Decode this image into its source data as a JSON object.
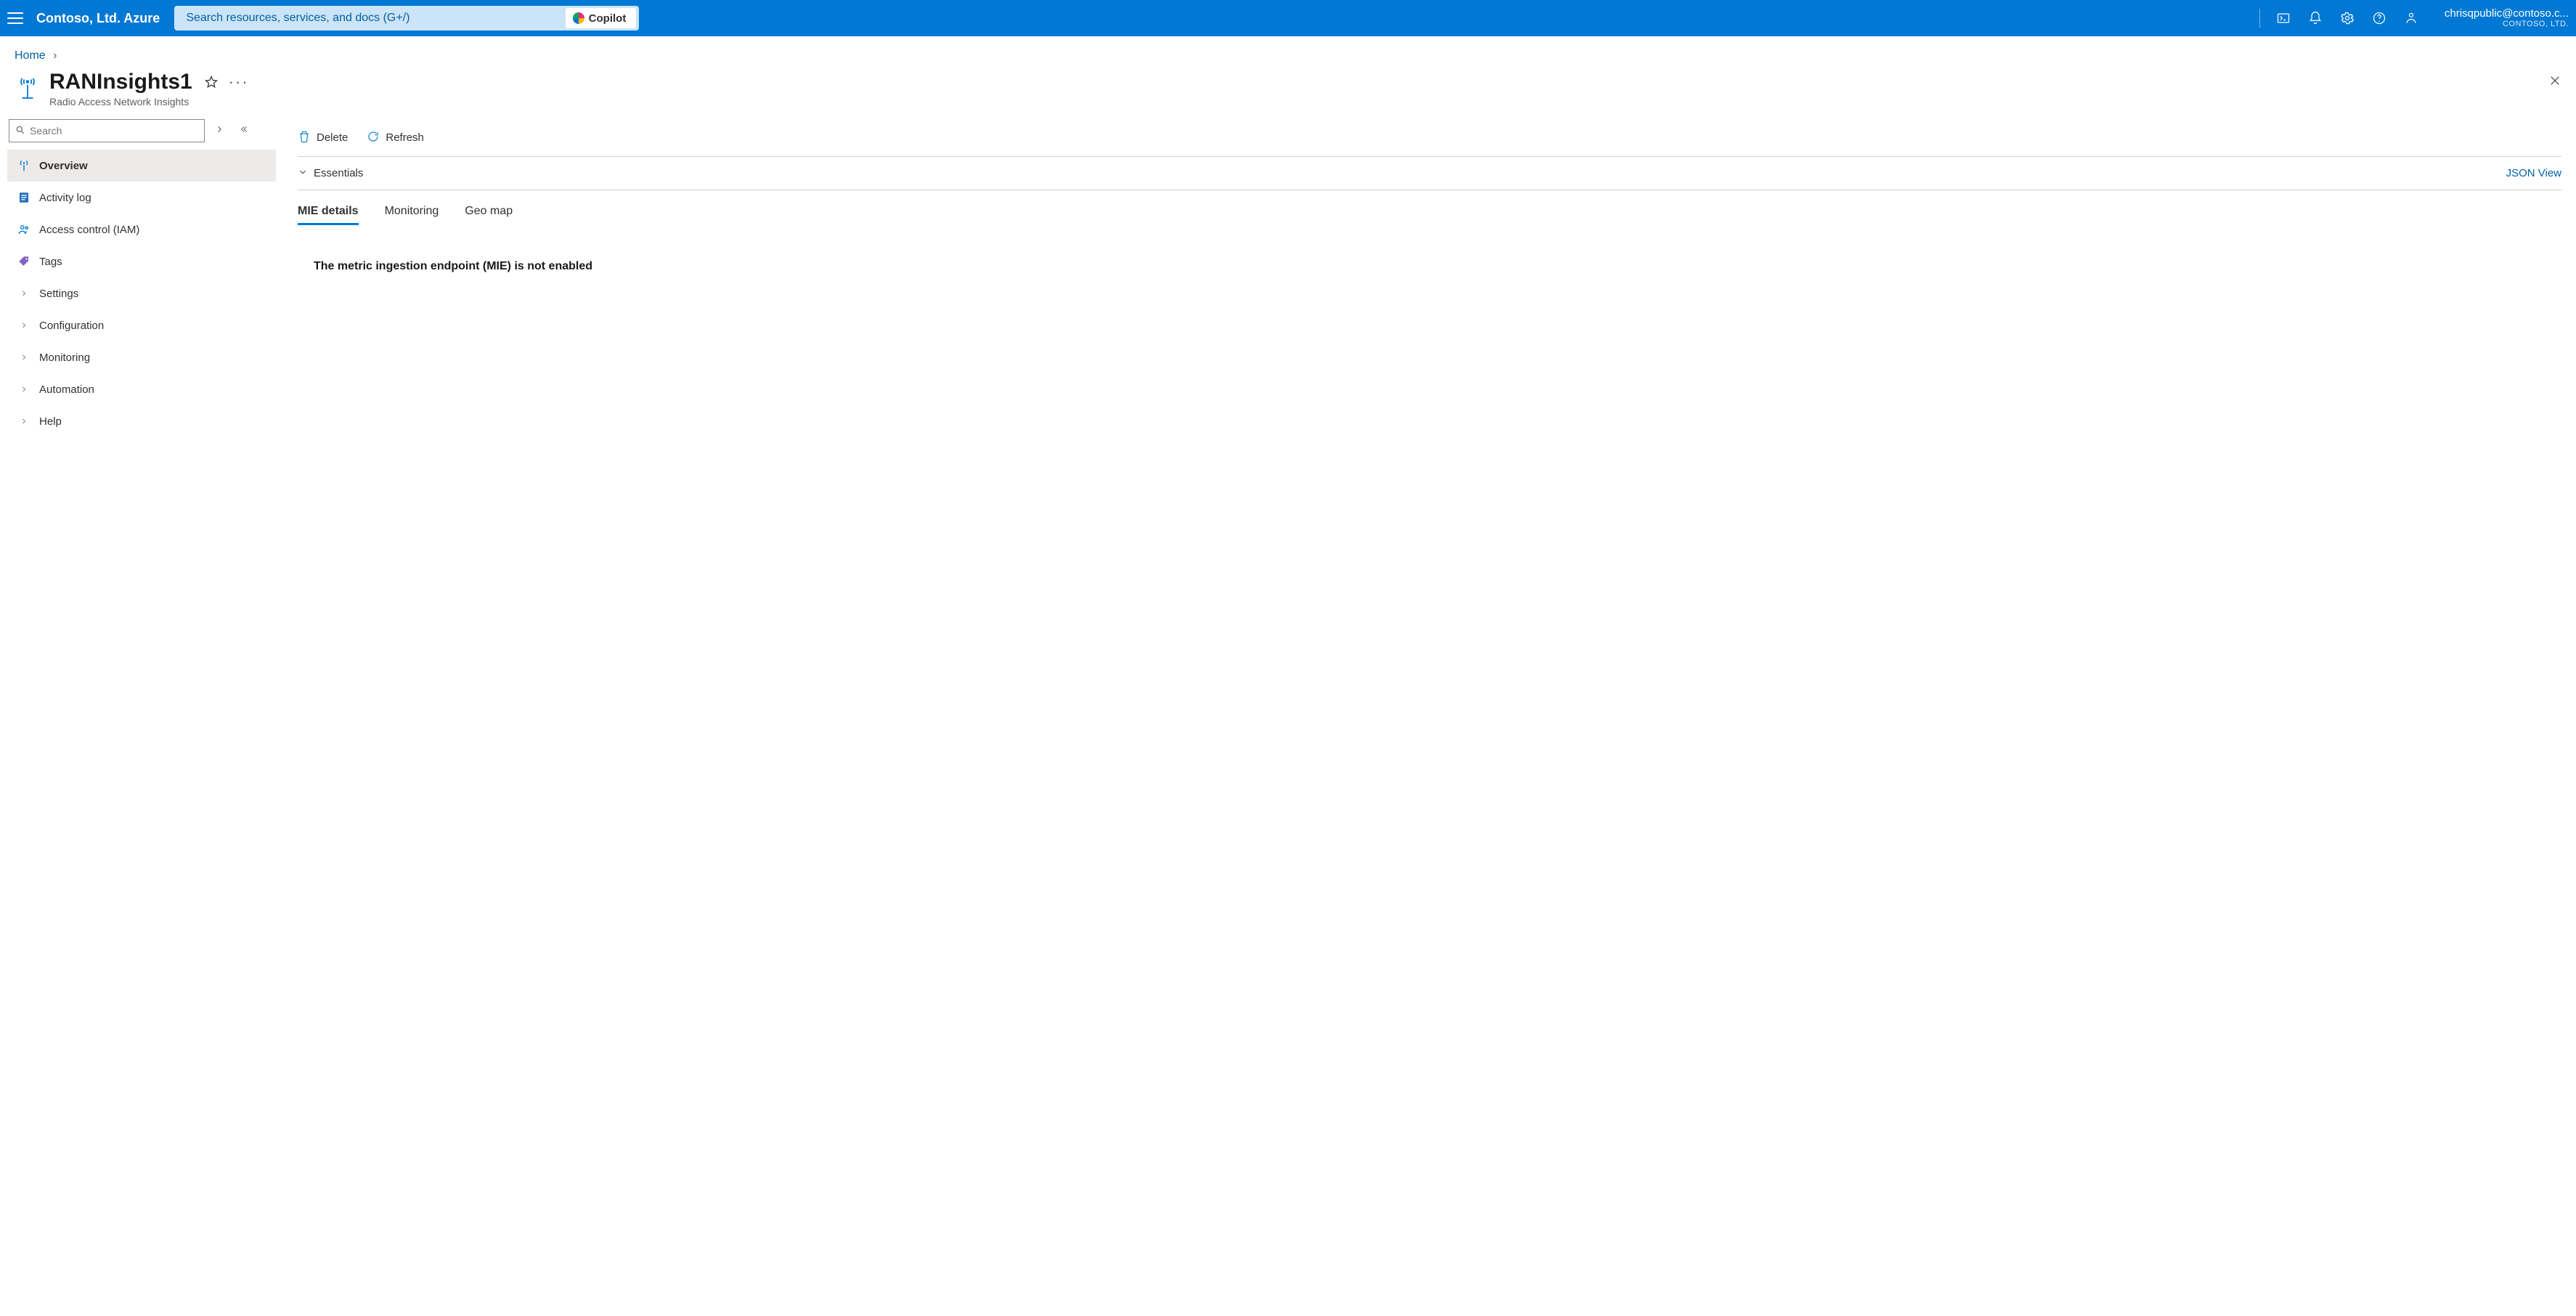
{
  "topbar": {
    "brand": "Contoso, Ltd. Azure",
    "search_placeholder": "Search resources, services, and docs (G+/)",
    "copilot_label": "Copilot",
    "account_email": "chrisqpublic@contoso.c...",
    "account_tenant": "CONTOSO, LTD."
  },
  "breadcrumb": {
    "home": "Home"
  },
  "page": {
    "title": "RANInsights1",
    "subtitle": "Radio Access Network Insights"
  },
  "sidebar": {
    "search_placeholder": "Search",
    "items": [
      {
        "label": "Overview",
        "icon": "antenna",
        "active": true
      },
      {
        "label": "Activity log",
        "icon": "log",
        "active": false
      },
      {
        "label": "Access control (IAM)",
        "icon": "iam",
        "active": false
      },
      {
        "label": "Tags",
        "icon": "tag",
        "active": false
      },
      {
        "label": "Settings",
        "icon": "chevron",
        "active": false
      },
      {
        "label": "Configuration",
        "icon": "chevron",
        "active": false
      },
      {
        "label": "Monitoring",
        "icon": "chevron",
        "active": false
      },
      {
        "label": "Automation",
        "icon": "chevron",
        "active": false
      },
      {
        "label": "Help",
        "icon": "chevron",
        "active": false
      }
    ]
  },
  "commands": {
    "delete": "Delete",
    "refresh": "Refresh"
  },
  "essentials": {
    "label": "Essentials",
    "json_view": "JSON View"
  },
  "tabs": [
    {
      "label": "MIE details",
      "active": true
    },
    {
      "label": "Monitoring",
      "active": false
    },
    {
      "label": "Geo map",
      "active": false
    }
  ],
  "content": {
    "mie_message": "The metric ingestion endpoint (MIE) is not enabled"
  }
}
